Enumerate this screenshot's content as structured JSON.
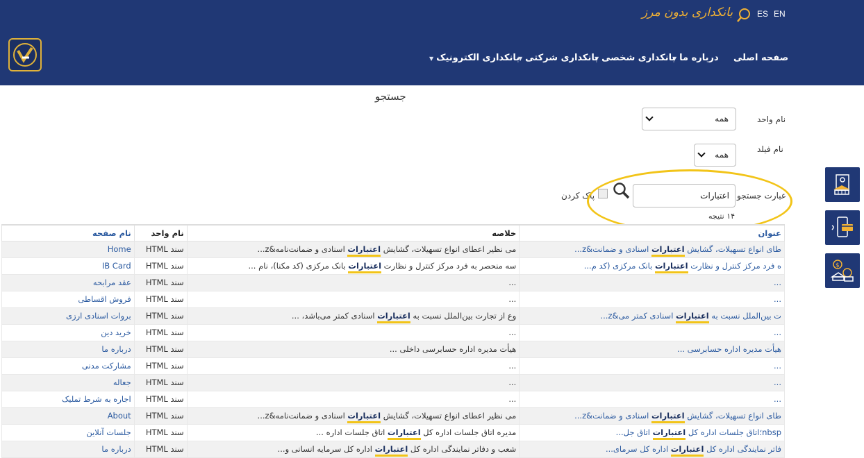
{
  "header": {
    "brand": "بانکداری بدون مرز",
    "languages": [
      "ES",
      "EN"
    ],
    "nav": [
      {
        "label": "صفحه اصلی",
        "caret": false
      },
      {
        "label": "درباره ما",
        "caret": true
      },
      {
        "label": "بانکداری شخصی",
        "caret": true
      },
      {
        "label": "بانکداری شرکتی",
        "caret": true
      },
      {
        "label": "بانکداری الکترونیک",
        "caret": true
      }
    ]
  },
  "search": {
    "title": "جستجو",
    "unit_label": "نام واحد",
    "unit_value": "همه",
    "field_label": "نام فیلد",
    "field_value": "همه",
    "query_label": "عبارت جستجو",
    "query_value": "اعتبارات",
    "clear_label": "پاک کردن",
    "result_count": "۱۴ نتیجه"
  },
  "table": {
    "headers": [
      "عنوان",
      "خلاصه",
      "نام واحد",
      "نام صفحه"
    ],
    "keyword": "اعتبارات",
    "rows": [
      {
        "title_pre": "طای انواع تسهیلات، گشایش ",
        "title_kw": "اعتبارات",
        "title_post": " اسنادی و ضمانت&z...",
        "sum_pre": "می نظیر اعطای انواع تسهیلات، گشایش ",
        "sum_kw": "اعتبارات",
        "sum_post": " اسنادی و ضمانت‌نامه&z...",
        "unit": "سند HTML",
        "page": "Home"
      },
      {
        "title_pre": "ه فرد مرکز کنترل و نظارت ",
        "title_kw": "اعتبارات",
        "title_post": " بانک مرکزی (کد م...",
        "sum_pre": "سه منحصر به فرد مرکز کنترل و نظارت ",
        "sum_kw": "اعتبارات",
        "sum_post": " بانک مرکزی (کد مکنا)، نام ...",
        "unit": "سند HTML",
        "page": "IB Card"
      },
      {
        "title_pre": "...",
        "title_kw": "",
        "title_post": "",
        "sum_pre": "...",
        "sum_kw": "",
        "sum_post": "",
        "unit": "سند HTML",
        "page": "عقد مرابحه"
      },
      {
        "title_pre": "...",
        "title_kw": "",
        "title_post": "",
        "sum_pre": "...",
        "sum_kw": "",
        "sum_post": "",
        "unit": "سند HTML",
        "page": "فروش اقساطی"
      },
      {
        "title_pre": "ت بین‌الملل نسبت به ",
        "title_kw": "اعتبارات",
        "title_post": " اسنادی کمتر می&z...",
        "sum_pre": "وع از تجارت بین‌الملل نسبت به ",
        "sum_kw": "اعتبارات",
        "sum_post": " اسنادی کمتر می‌باشد، ...",
        "unit": "سند HTML",
        "page": "بروات اسنادی ارزی"
      },
      {
        "title_pre": "...",
        "title_kw": "",
        "title_post": "",
        "sum_pre": "...",
        "sum_kw": "",
        "sum_post": "",
        "unit": "سند HTML",
        "page": "خرید دین"
      },
      {
        "title_pre": "هیأت مدیره اداره حسابرسی ...",
        "title_kw": "",
        "title_post": "",
        "sum_pre": "هیأت مدیره اداره حسابرسی داخلی ...",
        "sum_kw": "",
        "sum_post": "",
        "unit": "سند HTML",
        "page": "درباره ما"
      },
      {
        "title_pre": "...",
        "title_kw": "",
        "title_post": "",
        "sum_pre": "...",
        "sum_kw": "",
        "sum_post": "",
        "unit": "سند HTML",
        "page": "مشارکت مدنی"
      },
      {
        "title_pre": "...",
        "title_kw": "",
        "title_post": "",
        "sum_pre": "...",
        "sum_kw": "",
        "sum_post": "",
        "unit": "سند HTML",
        "page": "جعاله"
      },
      {
        "title_pre": "...",
        "title_kw": "",
        "title_post": "",
        "sum_pre": "...",
        "sum_kw": "",
        "sum_post": "",
        "unit": "سند HTML",
        "page": "اجاره به شرط تملیک"
      },
      {
        "title_pre": "طای انواع تسهیلات، گشایش ",
        "title_kw": "اعتبارات",
        "title_post": " اسنادی و ضمانت&z...",
        "sum_pre": "می نظیر اعطای انواع تسهیلات، گشایش ",
        "sum_kw": "اعتبارات",
        "sum_post": " اسنادی و ضمانت‌نامه&z...",
        "unit": "سند HTML",
        "page": "About"
      },
      {
        "title_pre": "nbsp؛اتاق جلسات اداره کل ",
        "title_kw": "اعتبارات",
        "title_post": " اتاق جل...",
        "sum_pre": "مدیره  اتاق جلسات اداره کل ",
        "sum_kw": "اعتبارات",
        "sum_post": "  اتاق جلسات اداره ...",
        "unit": "سند HTML",
        "page": "جلسات آنلاین"
      },
      {
        "title_pre": "فاتر نمایندگی اداره کل ",
        "title_kw": "اعتبارات",
        "title_post": " اداره کل سرمای...",
        "sum_pre": "شعب و دفاتر نمایندگی اداره کل ",
        "sum_kw": "اعتبارات",
        "sum_post": " اداره کل سرمایه انسانی و...",
        "unit": "سند HTML",
        "page": "درباره ما"
      }
    ]
  },
  "side_buttons": [
    "bank-document-icon",
    "mobile-card-icon",
    "currency-exchange-icon"
  ],
  "colors": {
    "header_bg": "#203875",
    "brand": "#f2b234",
    "highlight": "#f2c418",
    "link": "#2b5aa0"
  }
}
